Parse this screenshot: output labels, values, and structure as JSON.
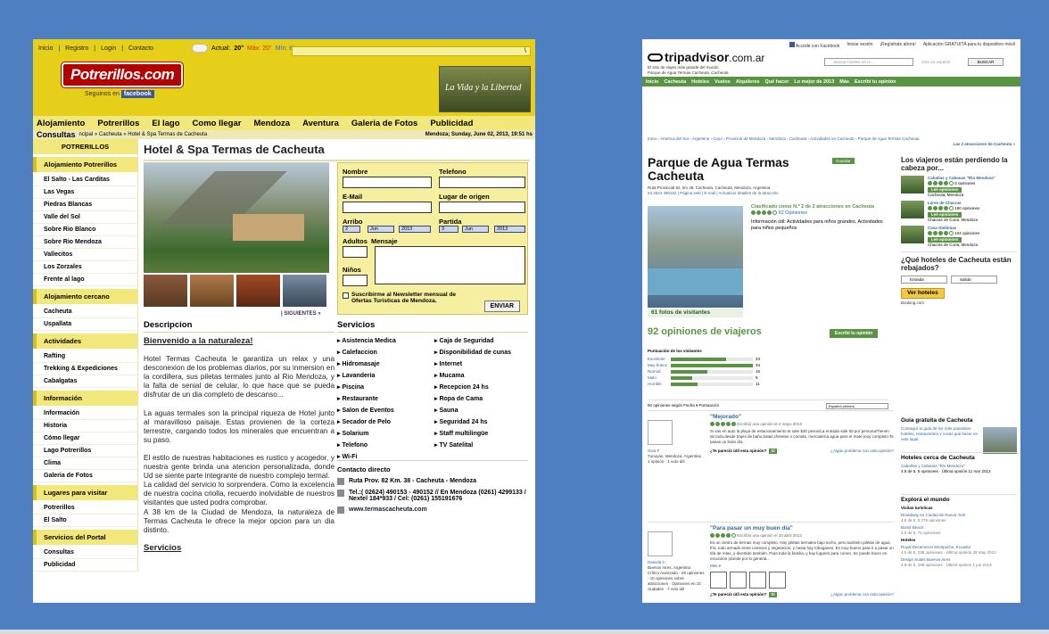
{
  "potrerillos": {
    "topnav": [
      "Inicio",
      "Registro",
      "Login",
      "Contacto"
    ],
    "weather": {
      "label": "Actual:",
      "current": "20°",
      "max": "Máx: 20°",
      "min": "Mín: 8°"
    },
    "search_arrow": "\\",
    "logo": "Potrerillos.com",
    "follow_label": "Seguinos en",
    "facebook": "facebook",
    "promo": "La Vida y la Libertad",
    "menu": [
      "Alojamiento",
      "Potrerillos",
      "El lago",
      "Como llegar",
      "Mendoza",
      "Aventura",
      "Galeria de Fotos",
      "Publicidad"
    ],
    "breadcrumb": {
      "label": "Consultas",
      "path": "ncipal » Cacheuta » Hotel & Spa Termas de Cacheuta",
      "date": "Mendoza; Sunday, June 02, 2013, 19:51 hs"
    },
    "sidebar": [
      {
        "type": "head",
        "label": "POTRERILLOS"
      },
      {
        "type": "head",
        "label": "Alojamiento Potrerillos"
      },
      {
        "type": "item",
        "label": "El Salto - Las Carditas"
      },
      {
        "type": "item",
        "label": "Las Vegas"
      },
      {
        "type": "item",
        "label": "Piedras Blancas"
      },
      {
        "type": "item",
        "label": "Valle del Sol"
      },
      {
        "type": "item",
        "label": "Sobre Rio Blanco"
      },
      {
        "type": "item",
        "label": "Sobre Rio Mendoza"
      },
      {
        "type": "item",
        "label": "Vallecitos"
      },
      {
        "type": "item",
        "label": "Los Zorzales"
      },
      {
        "type": "item",
        "label": "Frente al lago"
      },
      {
        "type": "head",
        "label": "Alojamiento cercano"
      },
      {
        "type": "item",
        "label": "Cacheuta"
      },
      {
        "type": "item",
        "label": "Uspallata"
      },
      {
        "type": "head",
        "label": "Actividades"
      },
      {
        "type": "item",
        "label": "Rafting"
      },
      {
        "type": "item",
        "label": "Trekking & Expediciones"
      },
      {
        "type": "item",
        "label": "Cabalgatas"
      },
      {
        "type": "head",
        "label": "Información"
      },
      {
        "type": "item",
        "label": "Información"
      },
      {
        "type": "item",
        "label": "Historia"
      },
      {
        "type": "item",
        "label": "Cómo llegar"
      },
      {
        "type": "item",
        "label": "Lago Potrerillos"
      },
      {
        "type": "item",
        "label": "Clima"
      },
      {
        "type": "item",
        "label": "Galeria de Fotos"
      },
      {
        "type": "head",
        "label": "Lugares para visitar"
      },
      {
        "type": "item",
        "label": "Potrerillos"
      },
      {
        "type": "item",
        "label": "El Salto"
      },
      {
        "type": "head",
        "label": "Servicios del Portal"
      },
      {
        "type": "item",
        "label": "Consultas"
      },
      {
        "type": "item",
        "label": "Publicidad"
      }
    ],
    "title": "Hotel & Spa Termas de Cacheuta",
    "next": "| SIGUIENTES »",
    "form": {
      "nombre": "Nombre",
      "telefono": "Telefono",
      "email": "E-Mail",
      "origen": "Lugar de origen",
      "arribo": "Arribo",
      "partida": "Partida",
      "arribo_day": "2",
      "arribo_month": "Jun",
      "arribo_year": "2013",
      "partida_day": "3",
      "partida_month": "Jun",
      "partida_year": "2013",
      "adultos": "Adultos",
      "mensaje": "Mensaje",
      "ninos": "Niños",
      "newsletter": "Suscribirme al Newsletter mensual de Ofertas Turisticas de Mendoza.",
      "send": "ENVIAR"
    },
    "desc_heading": "Descripcion",
    "serv_heading": "Servicios",
    "welcome": "Bienvenido a la naturaleza!",
    "paragraphs": [
      "Hotel Termas Cacheuta le garantiza un relax y una desconexion de los problemas diarios, por su inmersion en la cordillera, sus piletas termales junto al Rio Mendoza, y la falta de senial de celular, lo que hace que se pueda disfrutar de un dia completo de descanso...",
      "La aguas termales son la principal riqueza de Hotel junto al maravilloso paisaje. Estas provienen de la corteza terrestre, cargando todos los minerales que encuentran a su paso.",
      "El estilo de nuestras habitaciones es rustico y acogedor, y nuestra gente brinda una atencion personalizada, donde Ud se siente parte integrante de nuestro complejo termal.",
      "La calidad del servicio lo sorprendera. Como la excelencia de nuestra cocina criolla, recuerdo inolvidable de nuestros visitantes que usted podra comprobar.",
      "A 38 km de la Ciudad de Mendoza, la naturaleza de Termas Cacheuta le ofrece la mejor opcion para un dia distinto."
    ],
    "servicios2": "Servicios",
    "services": [
      "Asistencia Medica",
      "Caja de Seguridad",
      "Calefaccion",
      "Disponibilidad de cunas",
      "Hidromasaje",
      "Internet",
      "Lavanderia",
      "Mucama",
      "Piscina",
      "Recepcion 24 hs",
      "Restaurante",
      "Ropa de Cama",
      "Salon de Eventos",
      "Sauna",
      "Secador de Pelo",
      "Seguridad 24 hs",
      "Solarium",
      "Staff multilingüe",
      "Telefono",
      "TV Satelital",
      "Wi-Fi"
    ],
    "contact": {
      "heading": "Contacto directo",
      "address": "Ruta Prov. 82 Km. 38 - Cacheuta - Mendoza",
      "phone": "Tel.:( 02624) 490153 - 490152 // En Mendoza (0261) 4299133 / Nextel 184*933 / Cel: (0261) 155191676",
      "web": "www.termascacheuta.com"
    }
  },
  "tripadvisor": {
    "topbar": [
      "Accede con Facebook",
      "Iniciar sesión",
      "¡Regístrate ahora!",
      "Aplicación GRATUITA para tu dispositivo móvil"
    ],
    "logo": "tripadvisor",
    "domain": ".com.ar",
    "tagline1": "El sitio de viajes más grande del mundo",
    "tagline2": "Parque de Agua Termas Cacheuta, Cacheuta",
    "search_placeholder": "Buscar hoteles en tu...",
    "search_in": "Sólo en español",
    "search_btn": "BUSCAR",
    "nav": [
      "Inicio",
      "Cacheuta",
      "Hoteles",
      "Vuelos",
      "Alquileres",
      "Qué hacer",
      "Lo mejor de 2013",
      "Más",
      "Escribí tu opinión"
    ],
    "breadcrumb": "Inicio › América del Sur › Argentina › Cuyo › Provincia de Mendoza › Mendoza › Cacheuta › Actividades en Cacheuta › Parque de Agua Termas Cacheuta",
    "breadcrumb_right": "Las 2 atracciones de Cacheuta »",
    "name": "Parque de Agua Termas Cacheuta",
    "write_btn": "Guardar",
    "address": "Ruta Provincial 82, km 38, Cacheuta, Cacheuta, Mendoza, Argentina",
    "contact_links": "54 2624 490152 | Página web | E-mail | Actualizar detalles de la atracción",
    "photo_caption": "61 fotos de visitantes",
    "rank": "Clasificado como N.º 2 de 2 atracciones en Cacheuta",
    "rating_count": "92 Opiniones",
    "info": "Información útil: Actividades para niños grandes, Actividades para niños pequeños",
    "opinions_title": "92 opiniones de viajeros",
    "opinions_btn": "Escribí tu opinión",
    "hist_title": "Puntuación de los visitantes",
    "hist": [
      {
        "label": "Excelente",
        "count": "23",
        "value": 23
      },
      {
        "label": "Muy bueno",
        "count": "34",
        "value": 34
      },
      {
        "label": "Normal",
        "count": "15",
        "value": 15
      },
      {
        "label": "Malo",
        "count": "9",
        "value": 9
      },
      {
        "label": "Horrible",
        "count": "11",
        "value": 11
      }
    ],
    "sort": "92 opiniones según  Fecha ▾  Puntuación",
    "sort_lang": "Español primero",
    "reviews": [
      {
        "title": "\"Mejorado\"",
        "meta": "Escribió una opinión el 2 mayo 2013",
        "body": "Si vas en auto la playa de estacionamiento te sale $30 pesos/La entrada sale 50 por persona/Tienen de todo,desde trajes de baño,batas,chinelas o comida, mercadería,agua para el mate,muy completo.Te pasas un lindo día.",
        "user": "Gina F",
        "loc": "Tunuyán, Mendoza, Argentina",
        "stats": "1 opinión · 1 voto útil",
        "useful": "¿Te pareció útil esta opinión?",
        "report": "¿Algún problema con esta opinión?"
      },
      {
        "title": "\"Para pasar un muy buen dia\"",
        "meta": "Escribió una opinión el 20 abril 2013",
        "body": "Es un centro de termas muy completo. Hay piletas termales bajo techo, pero también piletas de agua fría, todo armado entre caminos y vegetación, y hasta hay toboganes. Es muy bueno para ir a pasar un día de relax, y divertido también. Para toda la familia, y hay lugares para comer. Se puede hacer en excursión (donde por lo general...",
        "user": "Daniela C",
        "loc": "Buenos Aires, Argentina",
        "stats": "Crítico Avanzado · 26 opiniones · 10 opiniones sobre atracciones · Opiniones en 10 ciudades · 7 voto útil",
        "more": "Más ▾",
        "useful": "¿Te pareció útil esta opinión?",
        "report": "¿Algún problema con esta opinión?"
      }
    ],
    "side": {
      "heading": "Los viajeros están perdiendo la cabeza por...",
      "hotels": [
        {
          "name": "Cabañas y Cabanas \"Rio Mendoza\"",
          "reviews": "5 opiniones",
          "btn": "Leé opiniones",
          "loc": "Cacheuta, Mendoza"
        },
        {
          "name": "Lares de Chacras",
          "reviews": "160 opiniones",
          "btn": "Leé opiniones",
          "loc": "Chacras de Coria, Mendoza"
        },
        {
          "name": "Casa Glebinias",
          "reviews": "104 opiniones",
          "btn": "Leé opiniones",
          "loc": "Chacras de Coria, Mendoza"
        }
      ],
      "question": "¿Qué hoteles de Cacheuta están rebajados?",
      "checkin": "Entrada",
      "checkout": "Salida",
      "view_btn": "Ver hoteles",
      "booking": "Booking.com",
      "guide_h": "Guía gratuita de Cacheuta",
      "guide_t": "Conseguí tu guía de los más populares hoteles, restaurantes y cosas que hacer en este lugar.",
      "near_h": "Hoteles cerca de Cacheuta",
      "near_name": "Cabañas y Cabanas \"Rio Mendoza\"",
      "near_meta": "4.5 de 5, 5 opiniones · Última opinión 11 mar 2013",
      "explore_h": "Explorá el mundo",
      "explore": [
        {
          "sub": "Visitas turísticas"
        },
        {
          "name": "Broadway en Ciudad de Nueva York",
          "meta": "4.5 de 5, 3 276 opiniones"
        },
        {
          "name": "Bondi Beach",
          "meta": "4.0 de 5, 71 opiniones"
        },
        {
          "sub": "Hoteles"
        },
        {
          "name": "Royal Decameron Montpsche, Ecuador",
          "meta": "4.0 de 5, 238 opiniones · Última opinión 29 may 2013"
        },
        {
          "name": "Design Suites Buenos Aires",
          "meta": "3.5 de 5, 189 opiniones · Última opinión 1 jun 2013"
        }
      ]
    }
  }
}
